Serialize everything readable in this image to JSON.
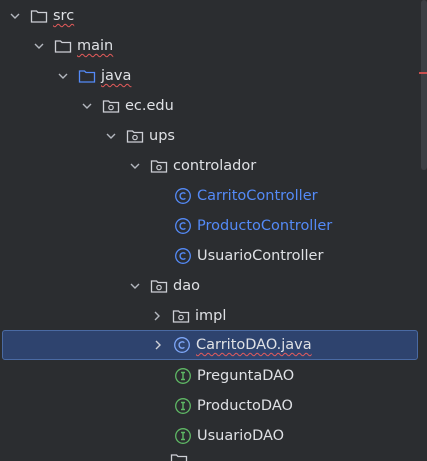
{
  "colors": {
    "background": "#2b2d30",
    "selection": "#2e436e",
    "selection_border": "#4a6aa3",
    "text": "#dfe1e5",
    "modified_text": "#548af7",
    "class_icon": "#548af7",
    "interface_icon": "#5fb865",
    "error_underline": "#e55b5b"
  },
  "tree": {
    "nodes": [
      {
        "label": "src",
        "icon": "folder-icon",
        "expanded": true
      },
      {
        "label": "main",
        "icon": "folder-icon",
        "expanded": true
      },
      {
        "label": "java",
        "icon": "source-folder-icon",
        "expanded": true
      },
      {
        "label": "ec.edu",
        "icon": "package-icon",
        "expanded": true
      },
      {
        "label": "ups",
        "icon": "package-icon",
        "expanded": true
      },
      {
        "label": "controlador",
        "icon": "package-icon",
        "expanded": true
      },
      {
        "label": "CarritoController",
        "icon": "class-icon"
      },
      {
        "label": "ProductoController",
        "icon": "class-icon"
      },
      {
        "label": "UsuarioController",
        "icon": "class-icon"
      },
      {
        "label": "dao",
        "icon": "package-icon",
        "expanded": true
      },
      {
        "label": "impl",
        "icon": "package-icon",
        "expanded": false
      },
      {
        "label": "CarritoDAO.java",
        "icon": "class-icon",
        "expanded": false,
        "selected": true
      },
      {
        "label": "PreguntaDAO",
        "icon": "interface-icon"
      },
      {
        "label": "ProductoDAO",
        "icon": "interface-icon"
      },
      {
        "label": "UsuarioDAO",
        "icon": "interface-icon"
      }
    ]
  }
}
